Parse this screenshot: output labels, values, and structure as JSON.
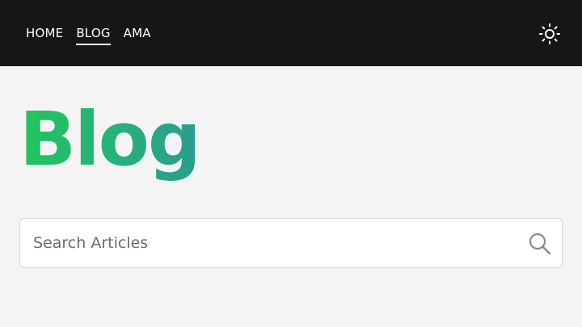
{
  "nav": {
    "items": [
      {
        "label": "HOME"
      },
      {
        "label": "BLOG",
        "active": true
      },
      {
        "label": "AMA"
      }
    ],
    "theme_toggle_icon": "sun-icon"
  },
  "page": {
    "title": "Blog",
    "title_gradient": [
      "#22c55e",
      "#2a9d8f"
    ]
  },
  "search": {
    "placeholder": "Search Articles",
    "value": "",
    "icon": "search-icon"
  },
  "colors": {
    "navbar_bg": "#161616",
    "page_bg": "#f4f4f4",
    "nav_text": "#ffffff"
  }
}
